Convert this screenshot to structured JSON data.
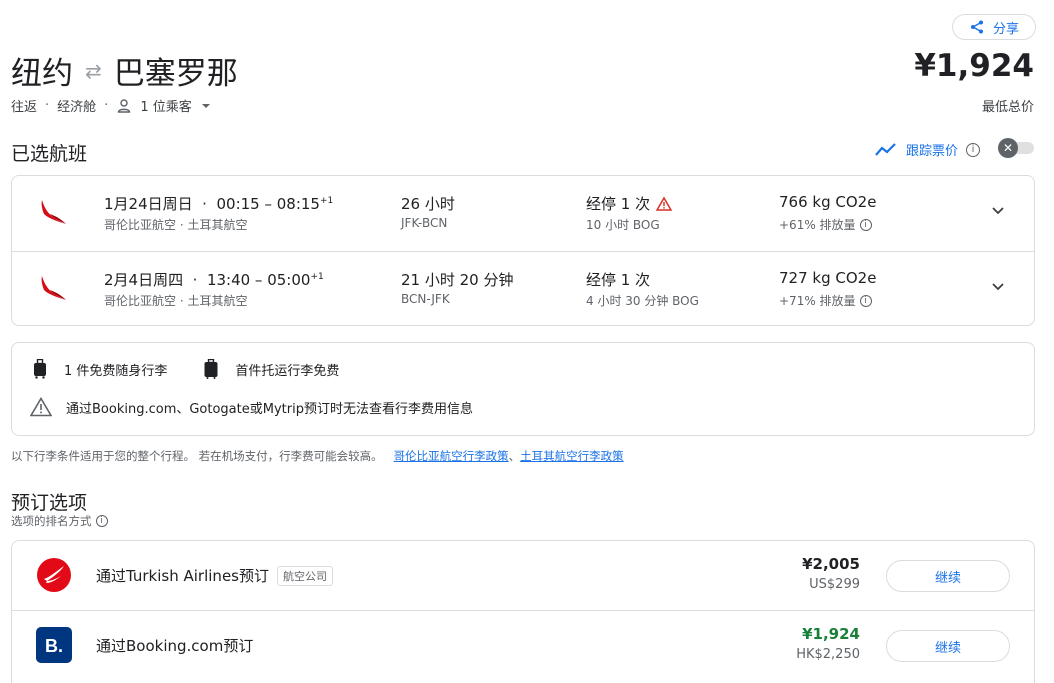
{
  "header": {
    "share_label": "分享",
    "origin": "纽约",
    "destination": "巴塞罗那",
    "trip_type": "往返",
    "cabin": "经济舱",
    "passengers": "1 位乘客",
    "total_price": "¥1,924",
    "total_price_label": "最低总价"
  },
  "selected": {
    "title": "已选航班",
    "track_label": "跟踪票价",
    "track_enabled": false
  },
  "flights": [
    {
      "date": "1月24日周日",
      "times": "00:15 – 08:15",
      "day_offset": "+1",
      "carriers": "哥伦比亚航空 · 土耳其航空",
      "duration": "26 小时",
      "route": "JFK-BCN",
      "stops": "经停 1 次",
      "warning": true,
      "layover": "10 小时 BOG",
      "co2": "766 kg CO2e",
      "emissions": "+61% 排放量"
    },
    {
      "date": "2月4日周四",
      "times": "13:40 – 05:00",
      "day_offset": "+1",
      "carriers": "哥伦比亚航空 · 土耳其航空",
      "duration": "21 小时 20 分钟",
      "route": "BCN-JFK",
      "stops": "经停 1 次",
      "warning": false,
      "layover": "4 小时 30 分钟 BOG",
      "co2": "727 kg CO2e",
      "emissions": "+71% 排放量"
    }
  ],
  "baggage": {
    "carry_on": "1 件免费随身行李",
    "checked": "首件托运行李免费",
    "warning": "通过Booking.com、Gotogate或Mytrip预订时无法查看行李费用信息",
    "note": "以下行李条件适用于您的整个行程。 若在机场支付，行李费可能会较高。",
    "policy_link_1": "哥伦比亚航空行李政策",
    "policy_sep": "、",
    "policy_link_2": "土耳其航空行李政策"
  },
  "booking": {
    "title": "预订选项",
    "sort_note": "选项的排名方式",
    "options": [
      {
        "name": "通过Turkish Airlines预订",
        "tag": "航空公司",
        "price": "¥2,005",
        "sub_price": "US$299",
        "button": "继续",
        "logo_color": "#e30a17"
      },
      {
        "name": "通过Booking.com预订",
        "tag": "",
        "price": "¥1,924",
        "sub_price": "HK$2,250",
        "button": "继续",
        "logo_color": "#003580",
        "logo_text": "B."
      }
    ]
  },
  "colors": {
    "accent": "#1a73e8",
    "good_price": "#188038",
    "warning": "#d93025"
  }
}
